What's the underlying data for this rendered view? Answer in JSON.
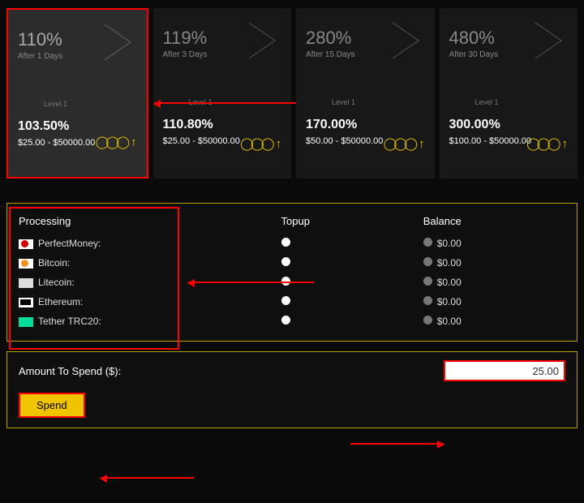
{
  "plans": [
    {
      "pct": "110%",
      "after": "After 1 Days",
      "level": "Level 1",
      "value": "103.50%",
      "range": "$25.00 - $50000.00"
    },
    {
      "pct": "119%",
      "after": "After 3 Days",
      "level": "Level 1",
      "value": "110.80%",
      "range": "$25.00 - $50000.00"
    },
    {
      "pct": "280%",
      "after": "After 15 Days",
      "level": "Level 1",
      "value": "170.00%",
      "range": "$50.00 - $50000.00"
    },
    {
      "pct": "480%",
      "after": "After 30 Days",
      "level": "Level 1",
      "value": "300.00%",
      "range": "$100.00 - $50000.00"
    }
  ],
  "table": {
    "head": {
      "processing": "Processing",
      "topup": "Topup",
      "balance": "Balance"
    },
    "rows": [
      {
        "name": "PerfectMoney:",
        "balance": "$0.00",
        "icon": "pm"
      },
      {
        "name": "Bitcoin:",
        "balance": "$0.00",
        "icon": "btc"
      },
      {
        "name": "Litecoin:",
        "balance": "$0.00",
        "icon": "ltc"
      },
      {
        "name": "Ethereum:",
        "balance": "$0.00",
        "icon": "eth"
      },
      {
        "name": "Tether TRC20:",
        "balance": "$0.00",
        "icon": "trc"
      }
    ]
  },
  "amount": {
    "label": "Amount To Spend ($):",
    "value": "25.00",
    "button": "Spend"
  }
}
